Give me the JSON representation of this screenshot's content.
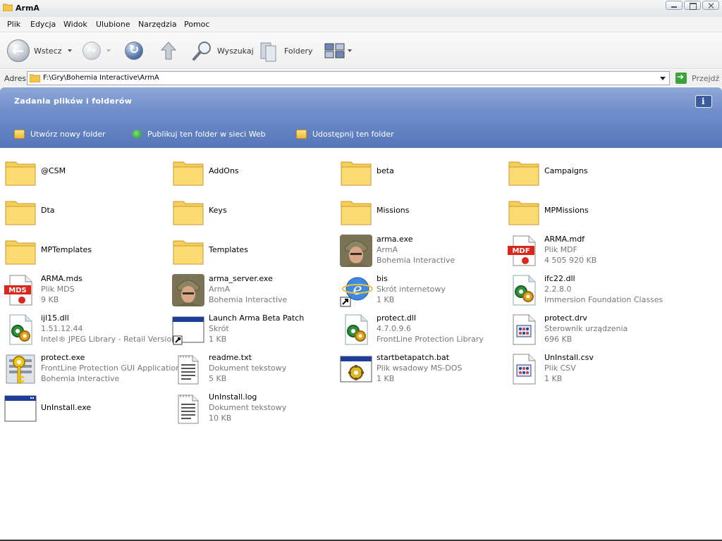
{
  "window": {
    "title": "ArmA"
  },
  "menu": [
    "Plik",
    "Edycja",
    "Widok",
    "Ulubione",
    "Narzędzia",
    "Pomoc"
  ],
  "toolbar": {
    "back_label": "Wstecz",
    "search_label": "Wyszukaj",
    "folders_label": "Foldery"
  },
  "address": {
    "label": "Adres",
    "path": "F:\\Gry\\Bohemia Interactive\\ArmA",
    "go_label": "Przejdź"
  },
  "tasks": {
    "title": "Zadania plików i folderów",
    "items": [
      "Utwórz nowy folder",
      "Publikuj ten folder w sieci Web",
      "Udostępnij ten folder"
    ]
  },
  "files": [
    {
      "name": "@CSM",
      "icon": "folder-icon",
      "lines": []
    },
    {
      "name": "AddOns",
      "icon": "folder-icon",
      "lines": []
    },
    {
      "name": "beta",
      "icon": "folder-icon",
      "lines": []
    },
    {
      "name": "Campaigns",
      "icon": "folder-icon",
      "lines": []
    },
    {
      "name": "Dta",
      "icon": "folder-icon",
      "lines": []
    },
    {
      "name": "Keys",
      "icon": "folder-icon",
      "lines": []
    },
    {
      "name": "Missions",
      "icon": "folder-icon",
      "lines": []
    },
    {
      "name": "MPMissions",
      "icon": "folder-icon",
      "lines": []
    },
    {
      "name": "MPTemplates",
      "icon": "folder-icon",
      "lines": []
    },
    {
      "name": "Templates",
      "icon": "folder-icon",
      "lines": []
    },
    {
      "name": "arma.exe",
      "icon": "soldier-icon",
      "lines": [
        "ArmA",
        "Bohemia Interactive"
      ]
    },
    {
      "name": "ARMA.mdf",
      "icon": "mdf-icon",
      "lines": [
        "Plik MDF",
        "4 505 920 KB"
      ]
    },
    {
      "name": "ARMA.mds",
      "icon": "mds-icon",
      "lines": [
        "Plik MDS",
        "9 KB"
      ]
    },
    {
      "name": "arma_server.exe",
      "icon": "soldier-icon",
      "lines": [
        "ArmA",
        "Bohemia Interactive"
      ]
    },
    {
      "name": "bis",
      "icon": "internet-shortcut-icon",
      "lines": [
        "Skrót internetowy",
        "1 KB"
      ]
    },
    {
      "name": "ifc22.dll",
      "icon": "dll-icon",
      "lines": [
        "2.2.8.0",
        "Immersion Foundation Classes"
      ]
    },
    {
      "name": "ijl15.dll",
      "icon": "dll-icon",
      "lines": [
        "1.51.12.44",
        "Intel® JPEG Library - Retail Version"
      ]
    },
    {
      "name": "Launch Arma Beta Patch",
      "icon": "shortcut-window-icon",
      "lines": [
        "Skrót",
        "1 KB"
      ]
    },
    {
      "name": "protect.dll",
      "icon": "dll-icon",
      "lines": [
        "4.7.0.9.6",
        "FrontLine Protection Library"
      ]
    },
    {
      "name": "protect.drv",
      "icon": "driver-icon",
      "lines": [
        "Sterownik urządzenia",
        "696 KB"
      ]
    },
    {
      "name": "protect.exe",
      "icon": "key-icon",
      "lines": [
        "FrontLine Protection GUI Application",
        "Bohemia Interactive"
      ]
    },
    {
      "name": "readme.txt",
      "icon": "text-file-icon",
      "lines": [
        "Dokument tekstowy",
        "5 KB"
      ]
    },
    {
      "name": "startbetapatch.bat",
      "icon": "batch-file-icon",
      "lines": [
        "Plik wsadowy MS-DOS",
        "1 KB"
      ]
    },
    {
      "name": "UnInstall.csv",
      "icon": "driver-icon",
      "lines": [
        "Plik CSV",
        "1 KB"
      ]
    },
    {
      "name": "UnInstall.exe",
      "icon": "app-window-icon",
      "lines": []
    },
    {
      "name": "UnInstall.log",
      "icon": "text-file-icon",
      "lines": [
        "Dokument tekstowy",
        "10 KB"
      ]
    }
  ]
}
